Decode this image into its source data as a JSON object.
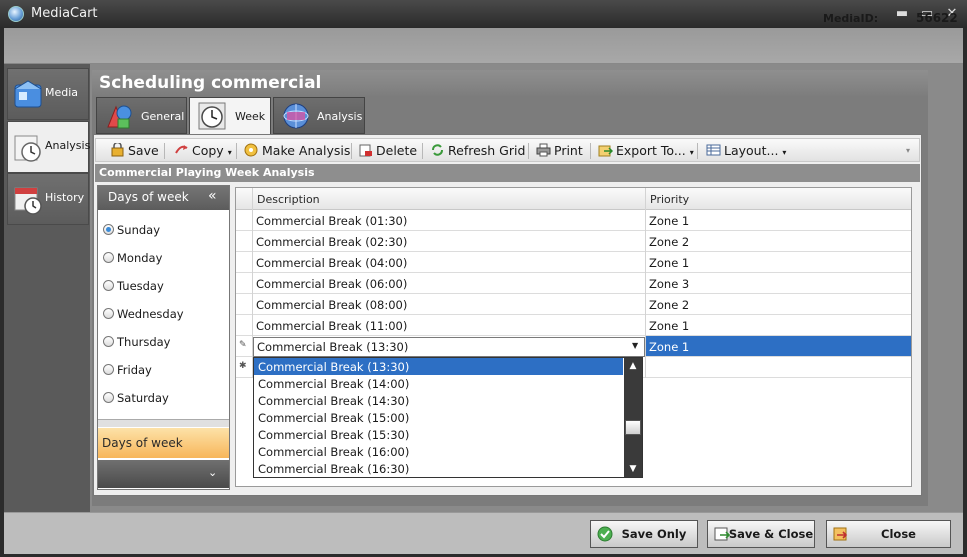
{
  "window": {
    "title": "MediaCart",
    "minimize": "▬",
    "maximize": "▭",
    "close": "✕"
  },
  "header": {
    "media_id_label": "MediaID:",
    "media_id_value": "56622"
  },
  "nav": {
    "items": [
      {
        "label": "Media",
        "icon": "media-cube-icon",
        "active": false
      },
      {
        "label": "Analysis",
        "icon": "analysis-clock-icon",
        "active": true
      },
      {
        "label": "History",
        "icon": "history-calendar-icon",
        "active": false
      }
    ]
  },
  "panel": {
    "title": "Scheduling commercial"
  },
  "tabs": [
    {
      "label": "General",
      "icon": "general-shapes-icon",
      "active": false
    },
    {
      "label": "Week",
      "icon": "week-clock-icon",
      "active": true
    },
    {
      "label": "Analysis",
      "icon": "analysis-globe-icon",
      "active": false
    }
  ],
  "toolbar": {
    "save": "Save",
    "copy": "Copy",
    "make_analysis": "Make Analysis",
    "delete": "Delete",
    "refresh_grid": "Refresh Grid",
    "print": "Print",
    "export_to": "Export To...",
    "layout": "Layout..."
  },
  "analysis_header": "Commercial Playing Week Analysis",
  "days": {
    "header": "Days of week",
    "collapse": "«",
    "items": [
      "Sunday",
      "Monday",
      "Tuesday",
      "Wednesday",
      "Thursday",
      "Friday",
      "Saturday"
    ],
    "selected": "Sunday",
    "footer_label": "Days of week",
    "footer_chevron": "⌄"
  },
  "grid": {
    "columns": [
      "Description",
      "Priority"
    ],
    "rows": [
      {
        "description": "Commercial Break (01:30)",
        "priority": "Zone 1"
      },
      {
        "description": "Commercial Break (02:30)",
        "priority": "Zone 2"
      },
      {
        "description": "Commercial Break (04:00)",
        "priority": "Zone 1"
      },
      {
        "description": "Commercial Break (06:00)",
        "priority": "Zone 3"
      },
      {
        "description": "Commercial Break (08:00)",
        "priority": "Zone 2"
      },
      {
        "description": "Commercial Break (11:00)",
        "priority": "Zone 1"
      }
    ],
    "edit_row": {
      "description": "Commercial Break (13:30)",
      "priority": "Zone 1",
      "indicator": "✎"
    },
    "new_row_indicator": "✱"
  },
  "dropdown": {
    "items": [
      "Commercial Break (13:30)",
      "Commercial Break (14:00)",
      "Commercial Break (14:30)",
      "Commercial Break (15:00)",
      "Commercial Break (15:30)",
      "Commercial Break (16:00)",
      "Commercial Break (16:30)"
    ],
    "highlighted": "Commercial Break (13:30)",
    "up": "▲",
    "down": "▼"
  },
  "buttons": {
    "save_only": "Save Only",
    "save_close": "Save & Close",
    "close": "Close"
  },
  "colors": {
    "selection": "#2d6fc4",
    "footer_accent": "#f7b65a",
    "titlebar": "#2a2a2a"
  }
}
